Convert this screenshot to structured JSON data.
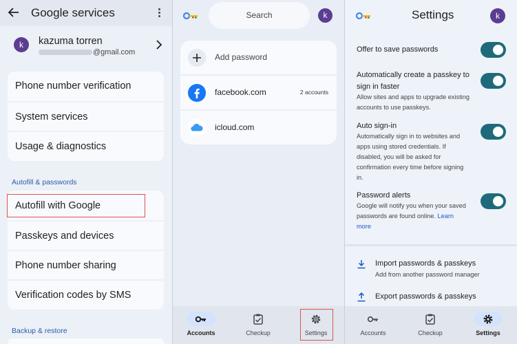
{
  "google_services": {
    "title": "Google services",
    "account": {
      "avatar_letter": "k",
      "name": "kazuma torren",
      "email_visible": "@gmail.com"
    },
    "rows_group1": [
      "Phone number verification",
      "System services",
      "Usage & diagnostics"
    ],
    "section_autofill": "Autofill & passwords",
    "rows_group2": [
      "Autofill with Google",
      "Passkeys and devices",
      "Phone number sharing",
      "Verification codes by SMS"
    ],
    "section_backup": "Backup & restore"
  },
  "password_manager": {
    "search_placeholder": "Search",
    "avatar_letter": "k",
    "add_password": "Add password",
    "entries": [
      {
        "site": "facebook.com",
        "count": "2 accounts",
        "icon": "facebook-icon"
      },
      {
        "site": "icloud.com",
        "count": "",
        "icon": "icloud-icon"
      }
    ],
    "nav": [
      {
        "label": "Accounts",
        "icon": "key-icon",
        "active": true
      },
      {
        "label": "Checkup",
        "icon": "checkup-icon",
        "active": false
      },
      {
        "label": "Settings",
        "icon": "gear-icon",
        "active": false
      }
    ]
  },
  "settings": {
    "title": "Settings",
    "avatar_letter": "k",
    "items": [
      {
        "title": "Offer to save passwords",
        "desc": "",
        "on": true
      },
      {
        "title": "Automatically create a passkey to sign in faster",
        "desc": "Allow sites and apps to upgrade existing accounts to use passkeys.",
        "on": true
      },
      {
        "title": "Auto sign-in",
        "desc": "Automatically sign in to websites and apps using stored credentials. If disabled, you will be asked for confirmation every time before signing in.",
        "on": true
      },
      {
        "title": "Password alerts",
        "desc": "Google will notify you when your saved passwords are found online.",
        "link": "Learn more",
        "on": true
      }
    ],
    "import": {
      "title": "Import passwords & passkeys",
      "desc": "Add from another password manager"
    },
    "export": {
      "title": "Export passwords & passkeys"
    },
    "nav": [
      {
        "label": "Accounts",
        "icon": "key-icon",
        "active": false
      },
      {
        "label": "Checkup",
        "icon": "checkup-icon",
        "active": false
      },
      {
        "label": "Settings",
        "icon": "gear-icon",
        "active": true
      }
    ]
  },
  "colors": {
    "toggle_on": "#1f6a7a",
    "avatar": "#5b3d91",
    "link": "#1a57c5",
    "nav_active": "#d3e3fd"
  }
}
